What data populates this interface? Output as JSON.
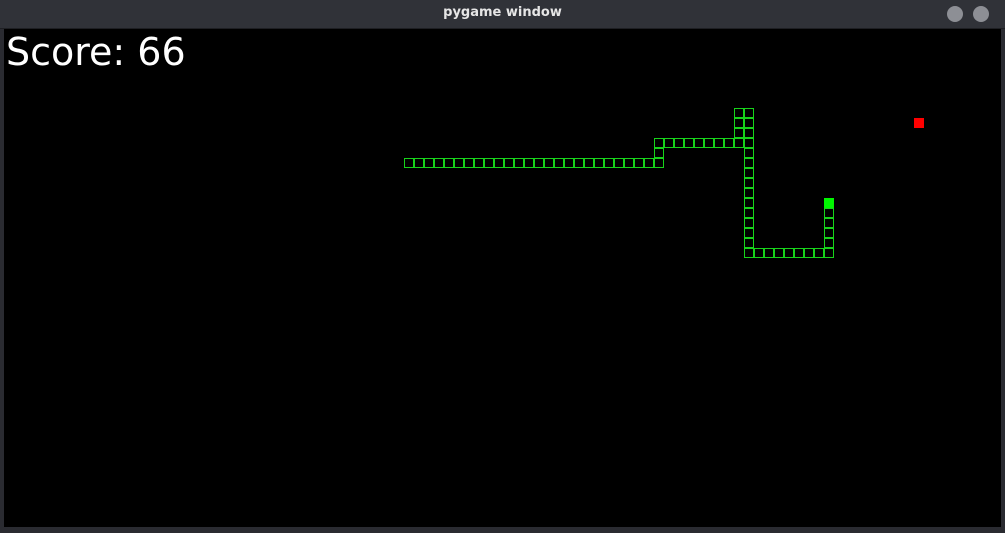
{
  "window": {
    "title": "pygame window",
    "controls": [
      "minimize",
      "close"
    ]
  },
  "game": {
    "score_label": "Score: 66",
    "score": 66,
    "colors": {
      "background": "#000000",
      "snake_body": "#17d21a",
      "snake_head": "#00f500",
      "food": "#ff0000",
      "score_text": "#ffffff"
    }
  }
}
